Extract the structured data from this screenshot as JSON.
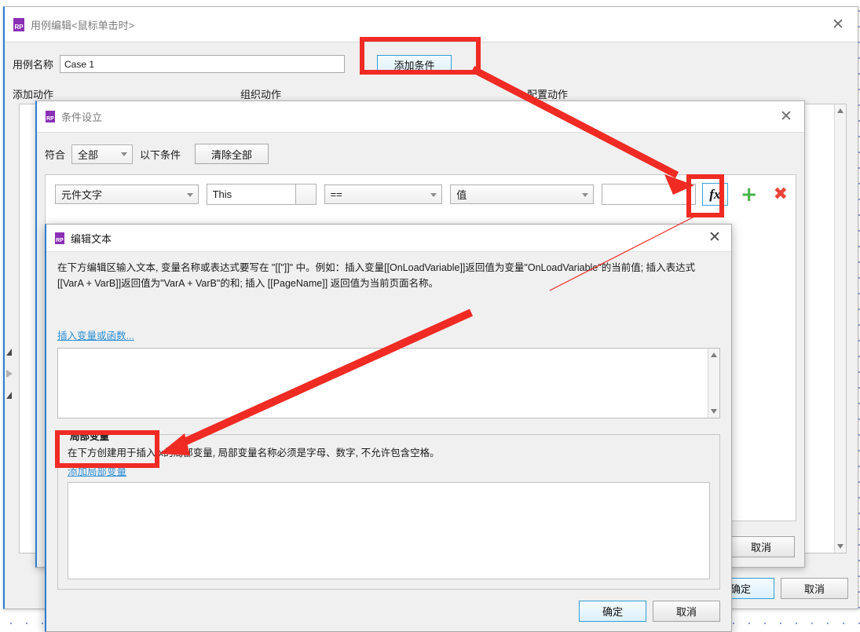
{
  "app": {
    "window_usecase": {
      "title": "用例编辑<鼠标单击时>",
      "logo": "rp-logo",
      "close_icon": "✕",
      "case_name_label": "用例名称",
      "case_name_value": "Case 1",
      "add_condition_button": "添加条件",
      "columns": [
        "添加动作",
        "组织动作",
        "配置动作"
      ],
      "footer": {
        "ok": "确定",
        "cancel": "取消"
      }
    },
    "window_condition": {
      "title": "条件设立",
      "close_icon": "✕",
      "match_label": "符合",
      "match_value": "全部",
      "condition_suffix_label": "以下条件",
      "clear_all_button": "清除全部",
      "row": {
        "subject": "元件文字",
        "target": "This",
        "operator": "==",
        "compare_type": "值",
        "value": "",
        "fx_button": "fx",
        "add_icon": "+",
        "remove_icon": "✖"
      },
      "footer": {
        "cancel": "取消"
      }
    },
    "window_edit_text": {
      "title": "编辑文本",
      "close_icon": "✕",
      "description": "在下方编辑区输入文本, 变量名称或表达式要写在 \"[[\"]]\" 中。例如：插入变量[[OnLoadVariable]]返回值为变量\"OnLoadVariable\"的当前值; 插入表达式[[VarA + VarB]]返回值为\"VarA + VarB\"的和; 插入 [[PageName]] 返回值为当前页面名称。",
      "insert_variable_link": "插入变量或函数...",
      "textarea_value": "",
      "local_variables": {
        "legend": "局部变量",
        "description": "在下方创建用于插入fx的局部变量, 局部变量名称必须是字母、数字, 不允许包含空格。",
        "add_link": "添加局部变量",
        "rows": []
      },
      "footer": {
        "ok": "确定",
        "cancel": "取消"
      }
    },
    "colors": {
      "accent_blue": "#2c7fd1",
      "annotation_red": "#ef2b24",
      "link_blue": "#2b8fd4",
      "plus_green": "#45b449",
      "remove_red": "#e8443a",
      "logo_purple": "#8b2fb5"
    }
  }
}
